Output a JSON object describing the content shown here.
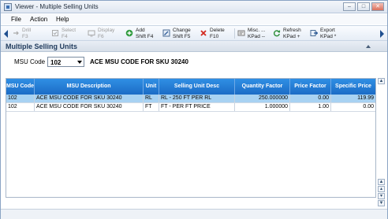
{
  "window": {
    "title": "Viewer - Multiple Selling Units"
  },
  "menu": {
    "items": [
      "File",
      "Action",
      "Help"
    ]
  },
  "toolbar": {
    "buttons": [
      {
        "line1": "Drill",
        "line2": "F3",
        "icon": "drill-icon",
        "enabled": false
      },
      {
        "line1": "Select",
        "line2": "F4",
        "icon": "select-icon",
        "enabled": false
      },
      {
        "line1": "Display",
        "line2": "F6",
        "icon": "display-icon",
        "enabled": false
      },
      {
        "line1": "Add",
        "line2": "Shift F4",
        "icon": "add-icon",
        "enabled": true
      },
      {
        "line1": "Change",
        "line2": "Shift F5",
        "icon": "change-icon",
        "enabled": true
      },
      {
        "line1": "Delete",
        "line2": "F10",
        "icon": "delete-icon",
        "enabled": true
      },
      {
        "line1": "Misc. ...",
        "line2": "KPad --",
        "icon": "misc-icon",
        "enabled": true
      },
      {
        "line1": "Refresh",
        "line2": "KPad +",
        "icon": "refresh-icon",
        "enabled": true
      },
      {
        "line1": "Export",
        "line2": "KPad *",
        "icon": "export-icon",
        "enabled": true
      }
    ]
  },
  "section": {
    "title": "Multiple Selling Units"
  },
  "msu": {
    "label": "MSU Code",
    "value": "102",
    "description": "ACE MSU CODE FOR SKU 30240"
  },
  "grid": {
    "columns": [
      "MSU Code",
      "MSU Description",
      "Unit",
      "Selling Unit Desc",
      "Quantity Factor",
      "Price Factor",
      "Specific Price"
    ],
    "rows": [
      [
        "102",
        "ACE MSU CODE FOR SKU 30240",
        "RL",
        "RL -   250 FT PER RL",
        "250.000000",
        "0.00",
        "119.99"
      ],
      [
        "102",
        "ACE MSU CODE FOR SKU 30240",
        "FT",
        "FT -   PER FT PRICE",
        "1.000000",
        "1.00",
        "0.00"
      ]
    ],
    "selected_row": 0
  },
  "colors": {
    "header_blue": "#1c6cc6",
    "selected_row": "#a8d2f2",
    "section_title": "#1f3a5c"
  }
}
